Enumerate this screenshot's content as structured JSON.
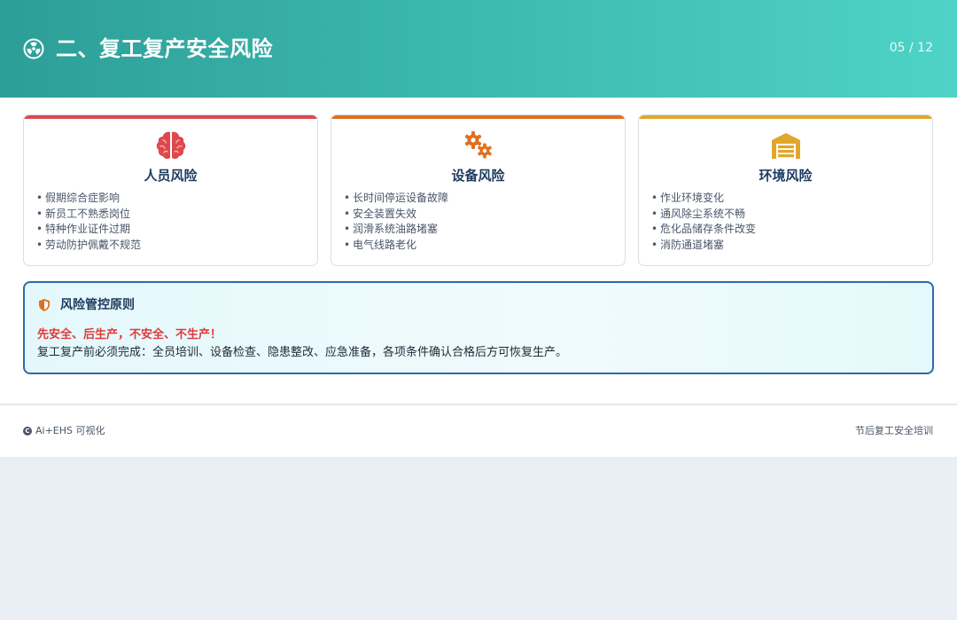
{
  "header": {
    "title": "二、复工复产安全风险",
    "icon": "radiation-icon",
    "page_indicator": "05 / 12"
  },
  "cards": [
    {
      "title": "人员风险",
      "icon": "brain-icon",
      "accent": "#e0474c",
      "items": [
        "假期综合症影响",
        "新员工不熟悉岗位",
        "特种作业证件过期",
        "劳动防护佩戴不规范"
      ]
    },
    {
      "title": "设备风险",
      "icon": "gears-icon",
      "accent": "#e0701e",
      "items": [
        "长时间停运设备故障",
        "安全装置失效",
        "润滑系统油路堵塞",
        "电气线路老化"
      ]
    },
    {
      "title": "环境风险",
      "icon": "warehouse-icon",
      "accent": "#e2a62a",
      "items": [
        "作业环境变化",
        "通风除尘系统不畅",
        "危化品储存条件改变",
        "消防通道堵塞"
      ]
    }
  ],
  "principle": {
    "icon": "shield-icon",
    "title": "风险管控原则",
    "warning": "先安全、后生产，不安全、不生产！",
    "text": "复工复产前必须完成：全员培训、设备检查、隐患整改、应急准备，各项条件确认合格后方可恢复生产。",
    "border_color": "#2d6aa8",
    "warning_color": "#e03a3a"
  },
  "footer": {
    "brand_icon": "copyright-icon",
    "brand": "Ai+EHS 可视化",
    "course": "节后复工安全培训"
  }
}
